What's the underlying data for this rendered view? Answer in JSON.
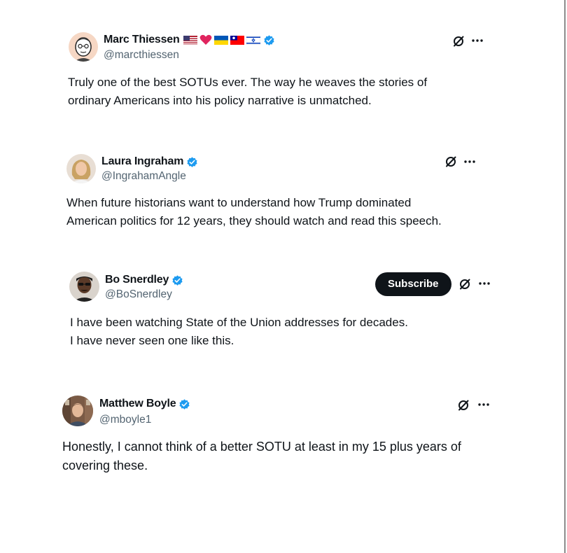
{
  "tweets": [
    {
      "name": "Marc Thiessen",
      "handle": "@marcthiessen",
      "line1": "Truly one of the best SOTUs ever. The way he weaves the stories of",
      "line2": "ordinary Americans into his policy narrative is unmatched.",
      "badges": [
        "us-flag-icon",
        "red-heart-icon",
        "ukraine-flag-icon",
        "taiwan-flag-icon",
        "israel-flag-icon"
      ]
    },
    {
      "name": "Laura Ingraham",
      "handle": "@IngrahamAngle",
      "line1": "When future historians want to understand how Trump dominated",
      "line2": "American politics for 12 years, they should watch and read this speech."
    },
    {
      "name": "Bo Snerdley",
      "handle": "@BoSnerdley",
      "subscribe_label": "Subscribe",
      "line1": "I have been watching State of the Union addresses for decades.",
      "line2": "I have never seen one like this."
    },
    {
      "name": "Matthew Boyle",
      "handle": "@mboyle1",
      "line1": "Honestly, I cannot think of a better SOTU at least in my 15 plus years of",
      "line2": "covering these."
    }
  ],
  "colors": {
    "text": "#0f1419",
    "secondary": "#536471",
    "verified_blue": "#1d9bf0",
    "subscribe_bg": "#0f1419"
  }
}
